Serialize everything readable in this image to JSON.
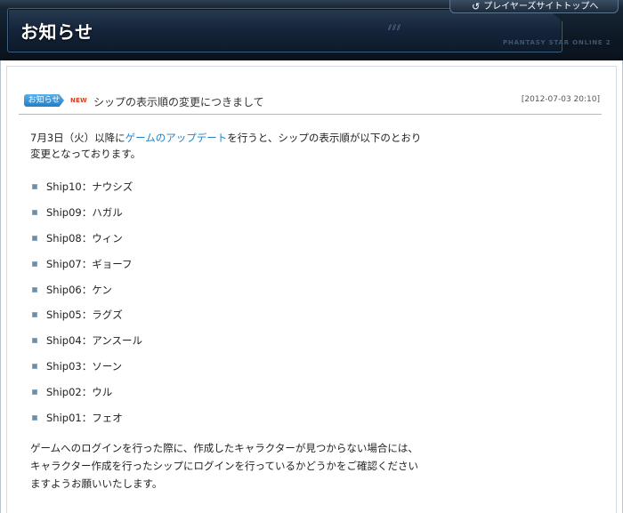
{
  "header": {
    "page_title": "お知らせ",
    "player_site_link": "プレイヤーズサイトトップへ",
    "logo_text": "PHANTASY STAR ONLINE 2"
  },
  "article": {
    "category_badge": "お知らせ",
    "new_badge": "NEW",
    "title": "シップの表示順の変更につきまして",
    "timestamp": "[2012-07-03 20:10]",
    "intro_before_link": "7月3日（火）以降に",
    "intro_link": "ゲームのアップデート",
    "intro_after_link_line1": "を行うと、シップの表示順が以下のとおり",
    "intro_line2": "変更となっております。",
    "ships": [
      "Ship10：ナウシズ",
      "Ship09：ハガル",
      "Ship08：ウィン",
      "Ship07：ギョーフ",
      "Ship06：ケン",
      "Ship05：ラグズ",
      "Ship04：アンスール",
      "Ship03：ソーン",
      "Ship02：ウル",
      "Ship01：フェオ"
    ],
    "footer_line1": "ゲームへのログインを行った際に、作成したキャラクターが見つからない場合には、",
    "footer_line2": "キャラクター作成を行ったシップにログインを行っているかどうかをご確認ください",
    "footer_line3": "ますようお願いいたします。"
  }
}
